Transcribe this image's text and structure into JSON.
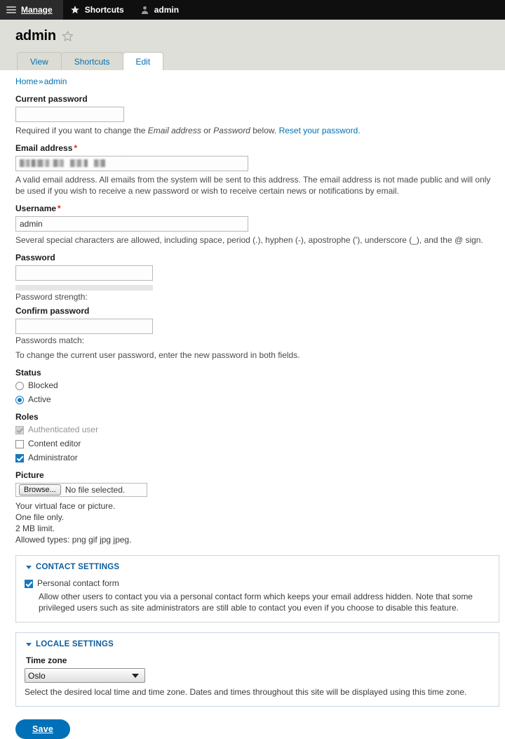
{
  "toolbar": {
    "manage": "Manage",
    "shortcuts": "Shortcuts",
    "account": "admin"
  },
  "header": {
    "title": "admin",
    "star_icon": "star-outline-icon",
    "tabs": [
      {
        "label": "View",
        "active": false
      },
      {
        "label": "Shortcuts",
        "active": false
      },
      {
        "label": "Edit",
        "active": true
      }
    ]
  },
  "breadcrumb": {
    "home": "Home",
    "separator": "»",
    "current": "admin"
  },
  "form": {
    "current_password": {
      "label": "Current password",
      "value": "",
      "desc_before": "Required if you want to change the ",
      "desc_em1": "Email address",
      "desc_mid": " or ",
      "desc_em2": "Password",
      "desc_after": " below. ",
      "desc_link": "Reset your password."
    },
    "email": {
      "label": "Email address",
      "required": "*",
      "value_redacted": true,
      "desc": "A valid email address. All emails from the system will be sent to this address. The email address is not made public and will only be used if you wish to receive a new password or wish to receive certain news or notifications by email."
    },
    "username": {
      "label": "Username",
      "required": "*",
      "value": "admin",
      "desc": "Several special characters are allowed, including space, period (.), hyphen (-), apostrophe ('), underscore (_), and the @ sign."
    },
    "password": {
      "label": "Password",
      "value": "",
      "strength_label": "Password strength:"
    },
    "confirm_password": {
      "label": "Confirm password",
      "value": "",
      "match_label": "Passwords match:",
      "desc": "To change the current user password, enter the new password in both fields."
    },
    "status": {
      "label": "Status",
      "options": [
        {
          "label": "Blocked",
          "selected": false
        },
        {
          "label": "Active",
          "selected": true
        }
      ]
    },
    "roles": {
      "label": "Roles",
      "options": [
        {
          "label": "Authenticated user",
          "checked": true,
          "disabled": true
        },
        {
          "label": "Content editor",
          "checked": false,
          "disabled": false
        },
        {
          "label": "Administrator",
          "checked": true,
          "disabled": false
        }
      ]
    },
    "picture": {
      "label": "Picture",
      "browse_label": "Browse...",
      "file_status": "No file selected.",
      "notes": [
        "Your virtual face or picture.",
        "One file only.",
        "2 MB limit.",
        "Allowed types: png gif jpg jpeg."
      ]
    },
    "contact_settings": {
      "legend": "CONTACT SETTINGS",
      "checkbox_label": "Personal contact form",
      "checked": true,
      "desc": "Allow other users to contact you via a personal contact form which keeps your email address hidden. Note that some privileged users such as site administrators are still able to contact you even if you choose to disable this feature."
    },
    "locale_settings": {
      "legend": "LOCALE SETTINGS",
      "timezone_label": "Time zone",
      "timezone_value": "Oslo",
      "timezone_options": [
        "Oslo"
      ],
      "desc": "Select the desired local time and time zone. Dates and times throughout this site will be displayed using this time zone."
    },
    "save_label": "Save"
  },
  "colors": {
    "toolbar_bg": "#0f0f0f",
    "header_band": "#dfdfd9",
    "link": "#0071b3",
    "accent": "#1878c0",
    "required": "#e32700",
    "fieldset_border": "#ccd6e0",
    "legend": "#0c5c9e",
    "save_bg": "#0071b8"
  }
}
